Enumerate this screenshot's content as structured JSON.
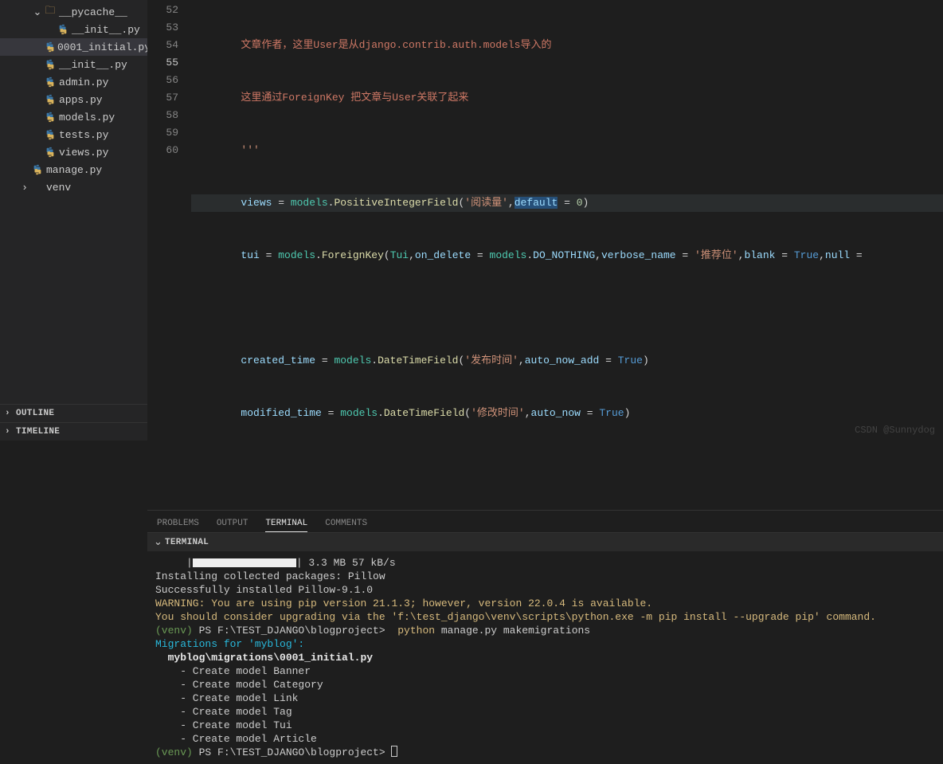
{
  "sidebar": {
    "tree": [
      {
        "kind": "chev",
        "chev": "⌄",
        "icon": "folder",
        "label": "__pycache__",
        "indent": "ind2"
      },
      {
        "kind": "file",
        "icon": "py",
        "label": "__init__.py",
        "indent": "ind3"
      },
      {
        "kind": "file",
        "icon": "py",
        "label": "0001_initial.py",
        "indent": "ind3",
        "sel": true
      },
      {
        "kind": "file",
        "icon": "py",
        "label": "__init__.py",
        "indent": "ind2"
      },
      {
        "kind": "file",
        "icon": "py",
        "label": "admin.py",
        "indent": "ind2"
      },
      {
        "kind": "file",
        "icon": "py",
        "label": "apps.py",
        "indent": "ind2"
      },
      {
        "kind": "file",
        "icon": "py",
        "label": "models.py",
        "indent": "ind2"
      },
      {
        "kind": "file",
        "icon": "py",
        "label": "tests.py",
        "indent": "ind2"
      },
      {
        "kind": "file",
        "icon": "py",
        "label": "views.py",
        "indent": "ind2"
      },
      {
        "kind": "file",
        "icon": "py",
        "label": "manage.py",
        "indent": "ind1"
      },
      {
        "kind": "chev",
        "chev": "›",
        "icon": "none",
        "label": "venv",
        "indent": "ind1"
      }
    ],
    "outline": "OUTLINE",
    "timeline": "TIMELINE"
  },
  "editor": {
    "lines": [
      52,
      53,
      54,
      55,
      56,
      57,
      58,
      59,
      60
    ],
    "current": 55,
    "code": {
      "l52": "        文章作者，这里User是从django.contrib.auth.models导入的",
      "l53": "        这里通过ForeignKey 把文章与User关联了起来",
      "l54": "        '''",
      "l55_a": "        views ",
      "l55_b": "=",
      "l55_c": " models",
      "l55_d": ".",
      "l55_e": "PositiveIntegerField",
      "l55_f": "(",
      "l55_g": "'阅读量'",
      "l55_h": ",",
      "l55_i": "default",
      "l55_j": " = ",
      "l55_k": "0",
      "l55_l": ")",
      "l56_a": "        tui ",
      "l56_b": "=",
      "l56_c": " models",
      "l56_d": ".",
      "l56_e": "ForeignKey",
      "l56_f": "(",
      "l56_g": "Tui",
      "l56_h": ",",
      "l56_i": "on_delete",
      "l56_j": " = ",
      "l56_k": "models",
      "l56_l": ".",
      "l56_m": "DO_NOTHING",
      "l56_n": ",",
      "l56_o": "verbose_name",
      "l56_p": " = ",
      "l56_q": "'推荐位'",
      "l56_r": ",",
      "l56_s": "blank",
      "l56_t": " = ",
      "l56_u": "True",
      "l56_v": ",",
      "l56_w": "null",
      "l56_x": " =",
      "l58_a": "        created_time ",
      "l58_b": "=",
      "l58_c": " models",
      "l58_d": ".",
      "l58_e": "DateTimeField",
      "l58_f": "(",
      "l58_g": "'发布时间'",
      "l58_h": ",",
      "l58_i": "auto_now_add",
      "l58_j": " = ",
      "l58_k": "True",
      "l58_l": ")",
      "l59_a": "        modified_time ",
      "l59_b": "=",
      "l59_c": " models",
      "l59_d": ".",
      "l59_e": "DateTimeField",
      "l59_f": "(",
      "l59_g": "'修改时间'",
      "l59_h": ",",
      "l59_i": "auto_now",
      "l59_j": " = ",
      "l59_k": "True",
      "l59_l": ")"
    }
  },
  "panel": {
    "tabs": {
      "problems": "PROBLEMS",
      "output": "OUTPUT",
      "terminal": "TERMINAL",
      "comments": "COMMENTS"
    },
    "terminal_hdr": "TERMINAL",
    "term": {
      "prog": "     |",
      "prog2": "| 3.3 MB 57 kB/s",
      "l1": "Installing collected packages: Pillow",
      "l2": "Successfully installed Pillow-9.1.0",
      "w1": "WARNING: You are using pip version 21.1.3; however, version 22.0.4 is available.",
      "w2": "You should consider upgrading via the 'f:\\test_django\\venv\\scripts\\python.exe -m pip install --upgrade pip' command.",
      "v1": "(venv) ",
      "ps1": "PS F:\\TEST_DJANGO\\blogproject> ",
      "cmd1": " python",
      "cmd1b": " manage.py makemigrations",
      "m1": "Migrations for 'myblog':",
      "m2": "  myblog\\migrations\\0001_initial.py",
      "m3": "    - Create model Banner",
      "m4": "    - Create model Category",
      "m5": "    - Create model Link",
      "m6": "    - Create model Tag",
      "m7": "    - Create model Tui",
      "m8": "    - Create model Article",
      "v2": "(venv) ",
      "ps2": "PS F:\\TEST_DJANGO\\blogproject> "
    }
  },
  "watermark": "CSDN @Sunnydog"
}
